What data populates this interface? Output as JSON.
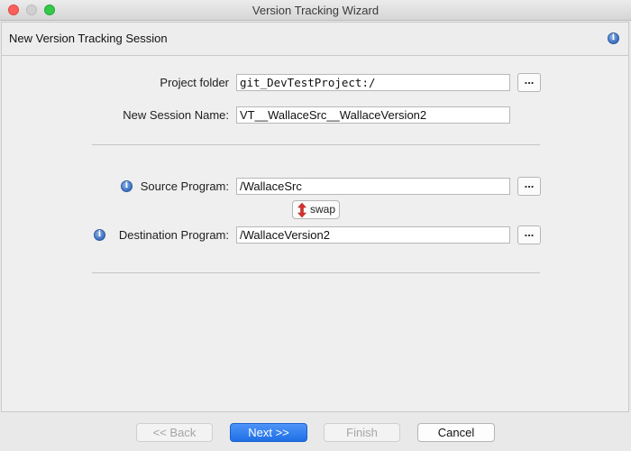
{
  "window": {
    "title": "Version Tracking Wizard"
  },
  "header": {
    "title": "New Version Tracking Session",
    "icon": "info-icon"
  },
  "form": {
    "project_folder_label": "Project folder",
    "project_folder_value": "git_DevTestProject:/",
    "session_name_label": "New Session Name:",
    "session_name_value": "VT__WallaceSrc__WallaceVersion2",
    "source_label": "Source Program:",
    "source_value": "/WallaceSrc",
    "destination_label": "Destination Program:",
    "destination_value": "/WallaceVersion2",
    "browse_label": "...",
    "swap_label": "swap"
  },
  "buttons": {
    "back": "<< Back",
    "next": "Next >>",
    "finish": "Finish",
    "cancel": "Cancel"
  },
  "colors": {
    "accent": "#1f6fe6",
    "close": "#fc605b",
    "maximize": "#34c84a",
    "swap_arrow": "#d9302c",
    "info": "#3b6fbf"
  }
}
